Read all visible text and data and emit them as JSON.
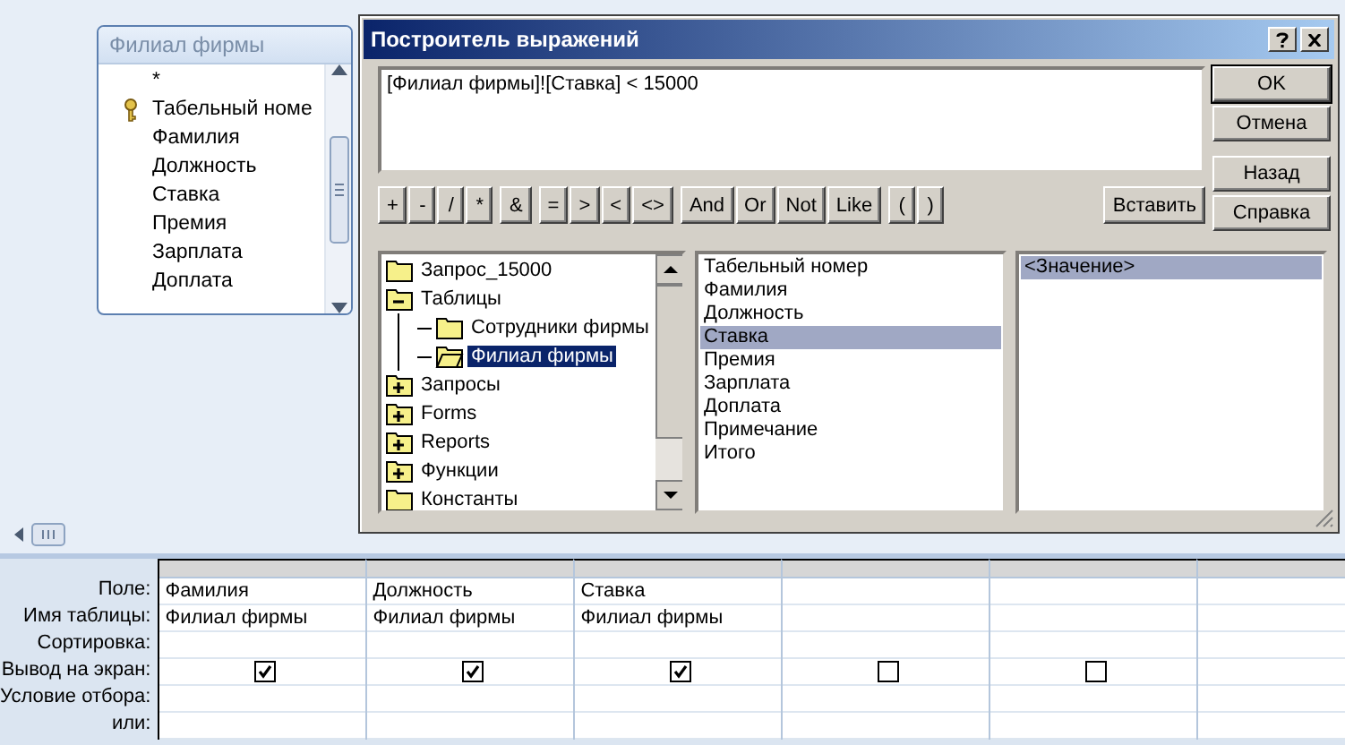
{
  "table_box": {
    "title": "Филиал фирмы",
    "fields": [
      {
        "name": "*",
        "key": false
      },
      {
        "name": "Табельный номе",
        "key": true
      },
      {
        "name": "Фамилия",
        "key": false
      },
      {
        "name": "Должность",
        "key": false
      },
      {
        "name": "Ставка",
        "key": false
      },
      {
        "name": "Премия",
        "key": false
      },
      {
        "name": "Зарплата",
        "key": false
      },
      {
        "name": "Доплата",
        "key": false
      }
    ]
  },
  "dialog": {
    "title": "Построитель выражений",
    "expression": "[Филиал фирмы]![Ставка] < 15000",
    "operators": [
      [
        "+",
        "-",
        "/",
        "*"
      ],
      [
        "&"
      ],
      [
        "=",
        ">",
        "<",
        "<>"
      ],
      [
        "And",
        "Or",
        "Not",
        "Like"
      ],
      [
        "(",
        ")"
      ]
    ],
    "insert_button": "Вставить",
    "side_buttons": [
      {
        "label": "OK",
        "default": true
      },
      {
        "label": "Отмена",
        "default": false
      },
      {
        "label": "Назад",
        "default": false
      },
      {
        "label": "Справка",
        "default": false
      }
    ],
    "tree": [
      {
        "label": "Запрос_15000",
        "kind": "leaf",
        "selected": false
      },
      {
        "label": "Таблицы",
        "kind": "expandable",
        "expanded": true,
        "selected": false,
        "children": [
          {
            "label": "Сотрудники фирмы",
            "kind": "leaf",
            "selected": false
          },
          {
            "label": "Филиал фирмы",
            "kind": "leaf",
            "selected": true
          }
        ]
      },
      {
        "label": "Запросы",
        "kind": "expandable",
        "expanded": false,
        "selected": false
      },
      {
        "label": "Forms",
        "kind": "expandable",
        "expanded": false,
        "selected": false
      },
      {
        "label": "Reports",
        "kind": "expandable",
        "expanded": false,
        "selected": false
      },
      {
        "label": "Функции",
        "kind": "expandable",
        "expanded": false,
        "selected": false
      },
      {
        "label": "Константы",
        "kind": "leaf",
        "selected": false
      }
    ],
    "fields": [
      {
        "label": "Табельный номер",
        "selected": false
      },
      {
        "label": "Фамилия",
        "selected": false
      },
      {
        "label": "Должность",
        "selected": false
      },
      {
        "label": "Ставка",
        "selected": true
      },
      {
        "label": "Премия",
        "selected": false
      },
      {
        "label": "Зарплата",
        "selected": false
      },
      {
        "label": "Доплата",
        "selected": false
      },
      {
        "label": "Примечание",
        "selected": false
      },
      {
        "label": "Итого",
        "selected": false
      }
    ],
    "values": [
      {
        "label": "<Значение>",
        "selected": true
      }
    ]
  },
  "grid": {
    "row_labels": [
      "Поле:",
      "Имя таблицы:",
      "Сортировка:",
      "Вывод на экран:",
      "Условие отбора:",
      "или:"
    ],
    "columns": [
      {
        "field": "Фамилия",
        "table": "Филиал фирмы",
        "show": true
      },
      {
        "field": "Должность",
        "table": "Филиал фирмы",
        "show": true
      },
      {
        "field": "Ставка",
        "table": "Филиал фирмы",
        "show": true
      },
      {
        "show": false
      },
      {
        "show": false
      },
      {}
    ]
  }
}
